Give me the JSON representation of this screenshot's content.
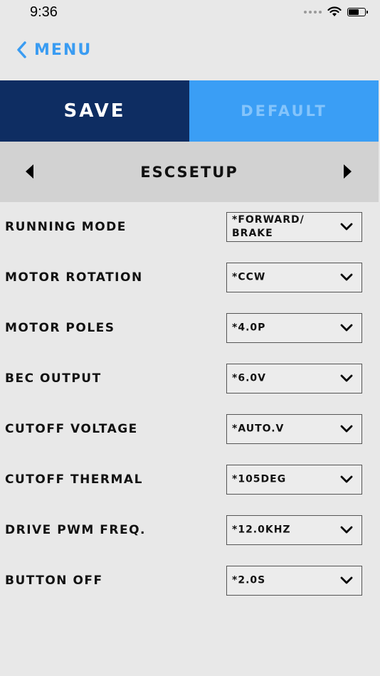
{
  "status_bar": {
    "time": "9:36"
  },
  "nav": {
    "back_label": "MENU"
  },
  "actions": {
    "save_label": "SAVE",
    "default_label": "DEFAULT"
  },
  "section": {
    "title": "ESCSETUP"
  },
  "settings": [
    {
      "label": "RUNNING MODE",
      "value": "*FORWARD/ BRAKE"
    },
    {
      "label": "MOTOR ROTATION",
      "value": "*CCW"
    },
    {
      "label": "MOTOR POLES",
      "value": "*4.0P"
    },
    {
      "label": "BEC OUTPUT",
      "value": "*6.0V"
    },
    {
      "label": "CUTOFF VOLTAGE",
      "value": "*AUTO.V"
    },
    {
      "label": "CUTOFF THERMAL",
      "value": "*105DEG"
    },
    {
      "label": "DRIVE PWM FREQ.",
      "value": "*12.0KHZ"
    },
    {
      "label": "BUTTON OFF",
      "value": "*2.0S"
    }
  ],
  "icons": {
    "back": "chevron-left-icon",
    "prev": "triangle-left-icon",
    "next": "triangle-right-icon",
    "dropdown": "chevron-down-icon",
    "wifi": "wifi-icon",
    "battery": "battery-icon",
    "signal": "signal-icon"
  },
  "colors": {
    "save_bg": "#0e2d62",
    "default_bg": "#3a9ef5",
    "accent": "#3a9cf2",
    "header_bg": "#d2d2d2",
    "page_bg": "#e8e8e8"
  }
}
